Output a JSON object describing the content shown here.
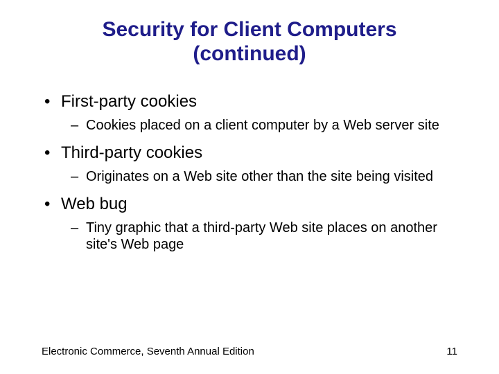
{
  "title_line1": "Security for Client Computers",
  "title_line2": "(continued)",
  "bullets": [
    {
      "text": "First-party cookies",
      "sub": "Cookies placed on a client computer by a Web server site"
    },
    {
      "text": "Third-party cookies",
      "sub": "Originates on a Web site other than the site being visited"
    },
    {
      "text": "Web bug",
      "sub": "Tiny graphic that a third-party Web site places on another site's Web page"
    }
  ],
  "footer_text": "Electronic Commerce, Seventh Annual Edition",
  "page_number": "11"
}
